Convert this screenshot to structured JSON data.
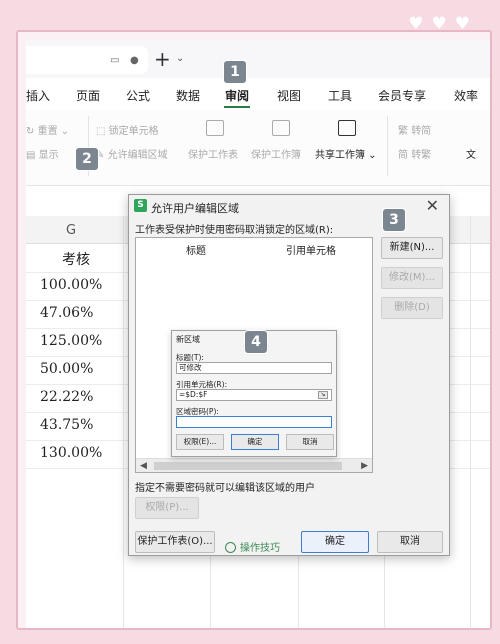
{
  "tabbar": {
    "plus": "+",
    "caret": "⌄"
  },
  "menu": [
    "插入",
    "页面",
    "公式",
    "数据",
    "审阅",
    "视图",
    "工具",
    "会员专享",
    "效率"
  ],
  "ribbon": {
    "redo": "重置",
    "show": "显示",
    "lock_cell": "锁定单元格",
    "allow_edit": "允许编辑区域",
    "protect_sheet": "保护工作表",
    "protect_book": "保护工作簿",
    "share_book": "共享工作簿",
    "trad": "转简",
    "simp": "转繁"
  },
  "sheet": {
    "column": "G",
    "header": "考核",
    "values": [
      "100.00%",
      "47.06%",
      "125.00%",
      "50.00%",
      "22.22%",
      "43.75%",
      "130.00%"
    ]
  },
  "badges": [
    "1",
    "2",
    "3",
    "4"
  ],
  "dialog": {
    "app_icon": "S",
    "title": "允许用户编辑区域",
    "close": "✕",
    "prompt": "工作表受保护时使用密码取消锁定的区域(R):",
    "col_title": "标题",
    "col_ref": "引用单元格",
    "btn_new": "新建(N)...",
    "btn_modify": "修改(M)...",
    "btn_delete": "删除(D)",
    "users_label": "指定不需要密码就可以编辑该区域的用户",
    "btn_permissions": "权限(P)...",
    "btn_protect": "保护工作表(O)...",
    "tips": "操作技巧",
    "btn_ok": "确定",
    "btn_cancel": "取消"
  },
  "subdialog": {
    "title": "新区域",
    "label_title": "标题(T):",
    "title_value": "可修改",
    "label_ref": "引用单元格(R):",
    "ref_value": "=$D:$F",
    "label_pwd": "区域密码(P):",
    "pwd_value": "",
    "btn_perm": "权限(E)...",
    "btn_ok": "确定",
    "btn_cancel": "取消"
  }
}
